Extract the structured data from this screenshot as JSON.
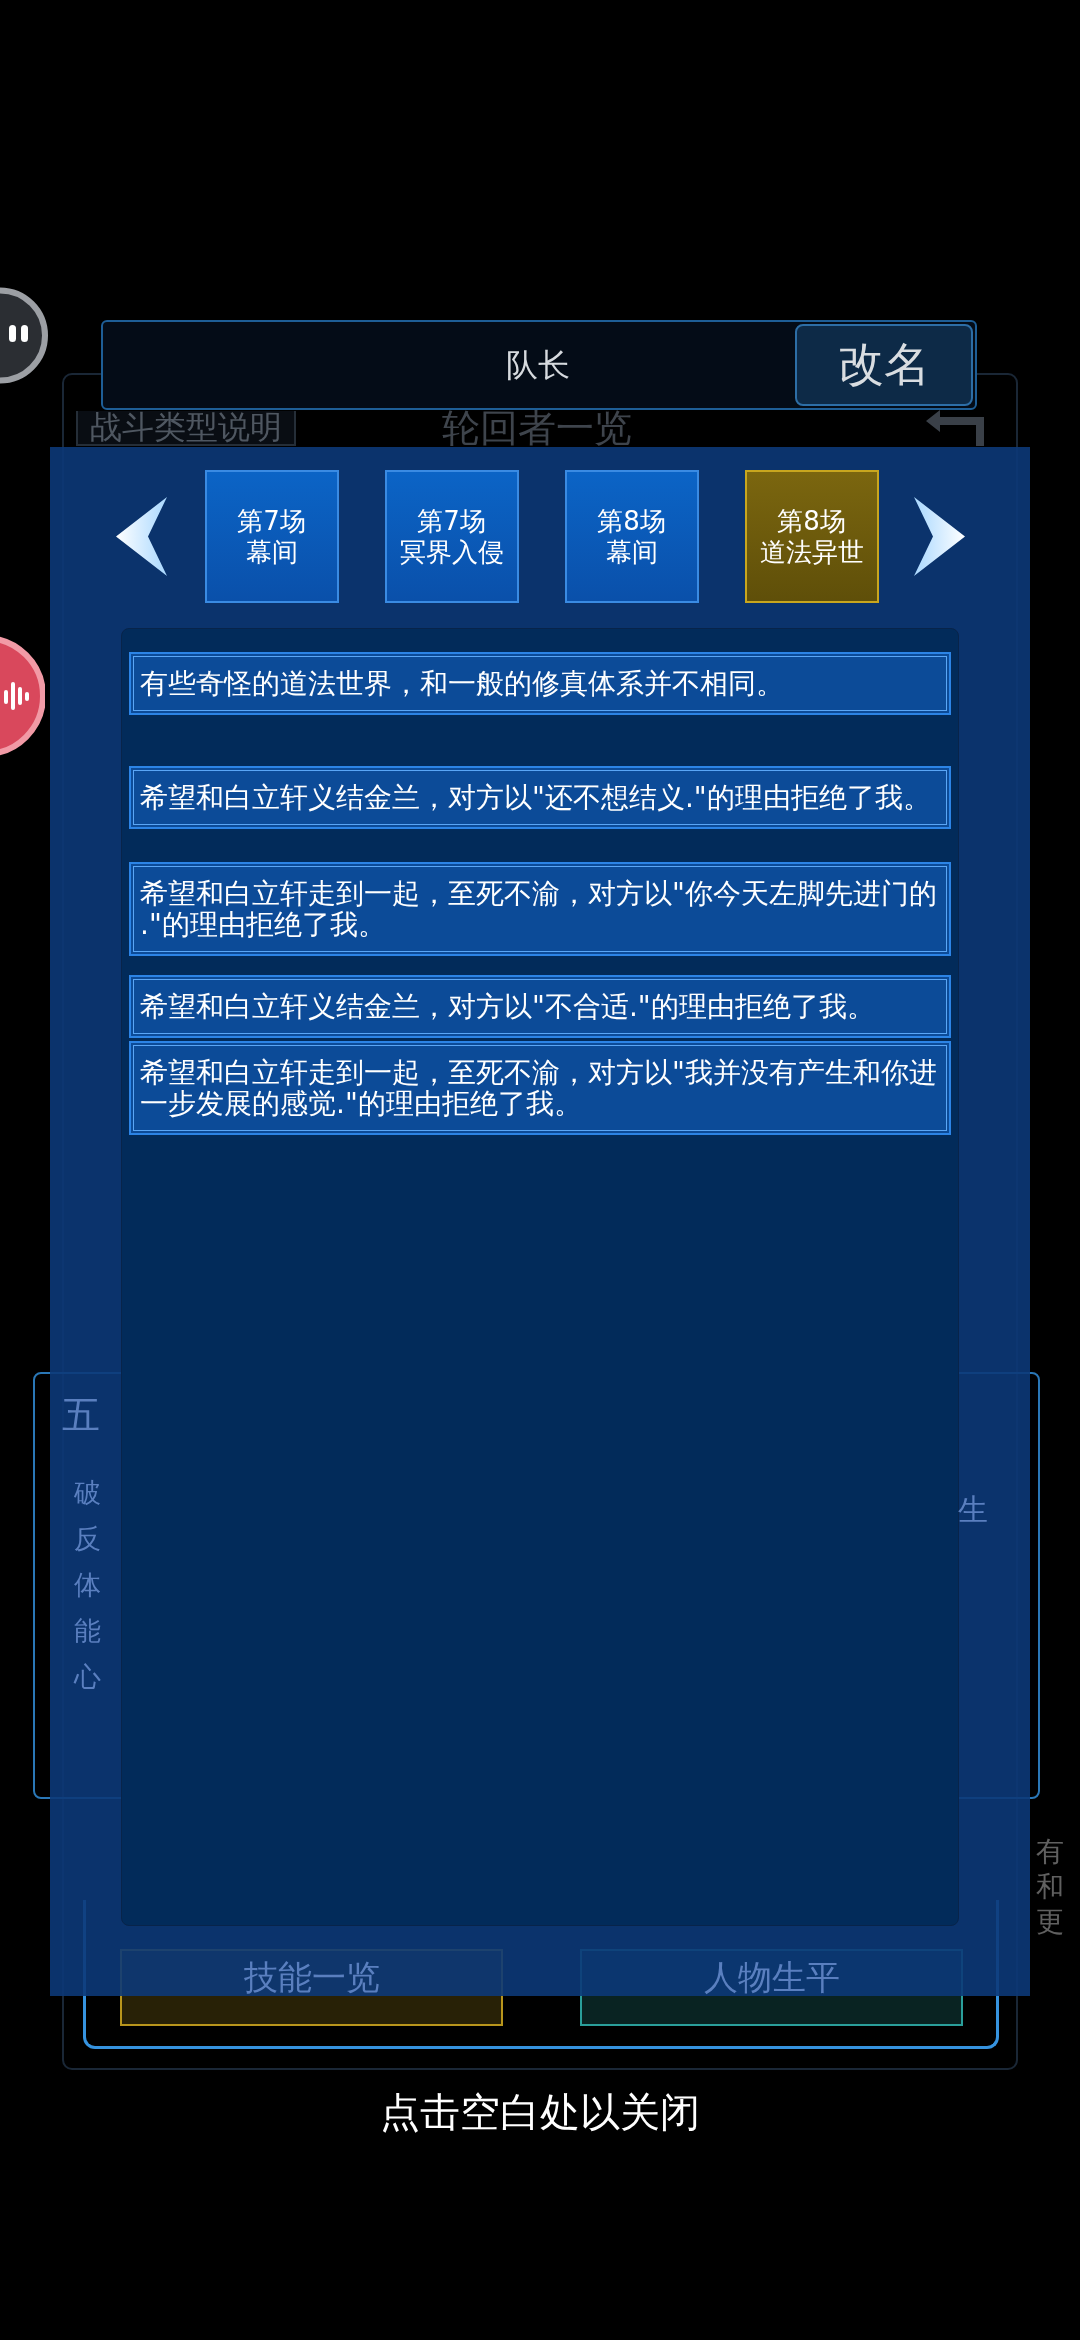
{
  "name_bar": {
    "name": "队长",
    "rename_button": "改名"
  },
  "background": {
    "tag": "战斗类型说明",
    "title": "轮回者一览",
    "section_title": "五",
    "stat_labels": [
      "破",
      "反",
      "体",
      "能",
      "心"
    ],
    "side_label": "生",
    "edge_text": [
      "有",
      "和",
      "更"
    ],
    "buttons": [
      {
        "label": "技能一览",
        "color": "#b8951c"
      },
      {
        "label": "人物生平",
        "color": "#2a9e9a"
      }
    ]
  },
  "dialog": {
    "tabs": [
      {
        "round": "第7场",
        "name": "幕间",
        "selected": false
      },
      {
        "round": "第7场",
        "name": "冥界入侵",
        "selected": false
      },
      {
        "round": "第8场",
        "name": "幕间",
        "selected": false
      },
      {
        "round": "第8场",
        "name": "道法异世",
        "selected": true
      }
    ],
    "entries": [
      "有些奇怪的道法世界，和一般的修真体系并不相同。",
      "希望和白立轩义结金兰，对方以\"还不想结义.\"的理由拒绝了我。",
      "希望和白立轩走到一起，至死不渝，对方以\"你今天左脚先进门的.\"的理由拒绝了我。",
      "希望和白立轩义结金兰，对方以\"不合适.\"的理由拒绝了我。",
      "希望和白立轩走到一起，至死不渝，对方以\"我并没有产生和你进一步发展的感觉.\"的理由拒绝了我。"
    ]
  },
  "close_hint": "点击空白处以关闭"
}
